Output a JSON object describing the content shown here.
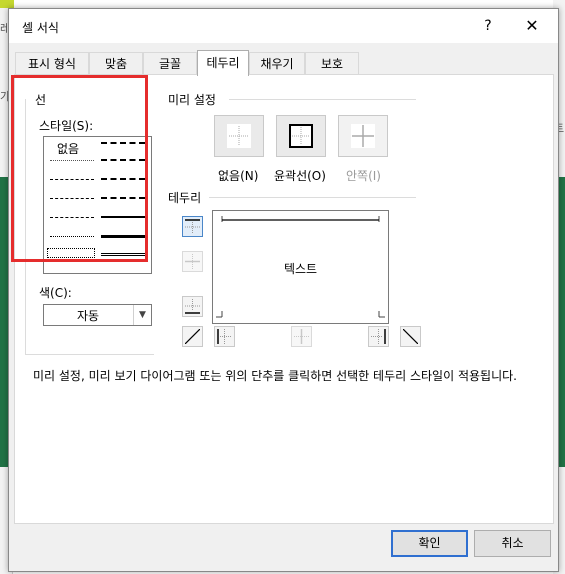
{
  "background": {
    "left_char": "레",
    "left_char2": "가",
    "right_char": "트",
    "accent": "#217346"
  },
  "window": {
    "title": "셀 서식",
    "help_label": "?",
    "close_label": "✕"
  },
  "tabs": [
    {
      "label": "표시 형식",
      "active": false
    },
    {
      "label": "맞춤",
      "active": false
    },
    {
      "label": "글꼴",
      "active": false
    },
    {
      "label": "테두리",
      "active": true
    },
    {
      "label": "채우기",
      "active": false
    },
    {
      "label": "보호",
      "active": false
    }
  ],
  "line_section": {
    "title": "선",
    "style_label": "스타일(S):",
    "none_label": "없음",
    "color_label": "색(C):",
    "color_value": "자동"
  },
  "preset_section": {
    "title": "미리 설정",
    "none_label": "없음(N)",
    "outline_label": "윤곽선(O)",
    "inside_label": "안쪽(I)"
  },
  "border_section": {
    "title": "테두리",
    "preview_text": "텍스트"
  },
  "hint_text": "미리 설정, 미리 보기 다이어그램 또는 위의 단추를 클릭하면 선택한 테두리 스타일이 적용됩니다.",
  "buttons": {
    "ok": "확인",
    "cancel": "취소"
  },
  "colors": {
    "highlight": "#e52d2d",
    "selected_button": "#4a86c8"
  },
  "icons": [
    "help-icon",
    "close-icon",
    "chevron-down-icon"
  ]
}
